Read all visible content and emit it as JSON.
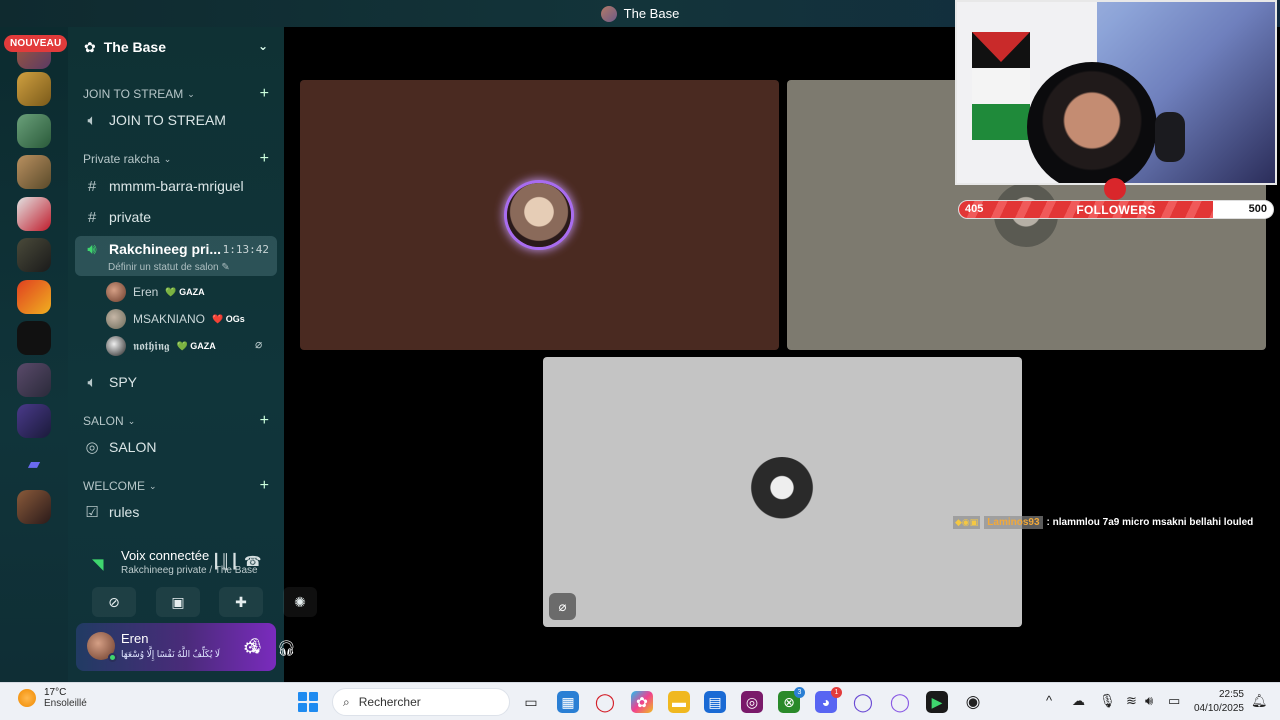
{
  "window": {
    "title": "The Base"
  },
  "rail": {
    "new_badge": "NOUVEAU"
  },
  "sidebar": {
    "server_name": "The Base",
    "categories": [
      {
        "label": "JOIN TO STREAM"
      },
      {
        "label": "Private rakcha"
      },
      {
        "label": "SALON"
      },
      {
        "label": "WELCOME"
      }
    ],
    "channels": {
      "join_to_stream": "JOIN TO STREAM",
      "mmmm": "mmmm-barra-mriguel",
      "private": "private",
      "active_voice": "Rakchineeg pri...",
      "active_timer": "1:13:42",
      "active_status": "Définir un statut de salon",
      "spy": "SPY",
      "salon": "SALON",
      "rules": "rules"
    },
    "members": [
      {
        "name": "Eren",
        "tag": "GAZA",
        "heart": "💚"
      },
      {
        "name": "MSAKNIANO",
        "tag": "OGs",
        "heart": "❤️"
      },
      {
        "name": "𝖓𝖔𝖙𝖍𝖎𝖓𝖌",
        "tag": "GAZA",
        "heart": "💚"
      }
    ]
  },
  "voice_panel": {
    "title": "Voix connectée",
    "subtitle": "Rakchineeg private / The Base"
  },
  "user_panel": {
    "name": "Eren",
    "status": "لَا يُكَلِّفُ اللَّهُ نَفْسًا إِلَّا وُسْعَهَا"
  },
  "overlay": {
    "followers_title": "FOLLOWERS",
    "followers_current": "405",
    "followers_goal": "500",
    "followers_fraction": 0.81,
    "chat_user": "Laminos93",
    "chat_message": ": nlammlou 7a9 micro msakni bellahi louled"
  },
  "taskbar": {
    "temperature": "17°C",
    "weather": "Ensoleillé",
    "search_placeholder": "Rechercher",
    "time": "22:55",
    "date": "04/10/2025",
    "badge_xbox": "3",
    "badge_discord": "1"
  },
  "colors": {
    "accent_green": "#3fd66e",
    "badge_red": "#e23b3b",
    "tile_brown": "#4a2a21",
    "tile_grey": "#7d7a6f",
    "tile_light": "#c4c4c4"
  }
}
